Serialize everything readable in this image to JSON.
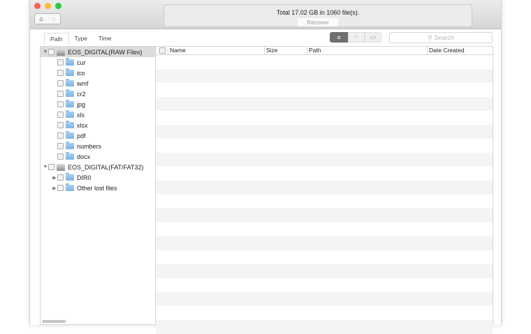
{
  "window": {
    "traffic_lights": {
      "close": "#fc5f57",
      "minimize": "#fdbc2e",
      "maximize": "#29c940"
    }
  },
  "toolbar": {
    "home_icon": "⌂",
    "back_icon": "○",
    "status_text": "Total 17.02 GB in 1060 file(s).",
    "recover_label": "Recover"
  },
  "tabs": [
    "Path",
    "Type",
    "Time"
  ],
  "view_icons": [
    "≡",
    "⁘",
    "▭"
  ],
  "search": {
    "placeholder": "Search",
    "icon": "⚲"
  },
  "tree": [
    {
      "label": "EOS_DIGITAL(RAW Files)",
      "type": "drive",
      "level": 0,
      "expand": "▼",
      "selected": true
    },
    {
      "label": "cur",
      "type": "folder",
      "level": 1
    },
    {
      "label": "ico",
      "type": "folder",
      "level": 1
    },
    {
      "label": "wmf",
      "type": "folder",
      "level": 1
    },
    {
      "label": "cr2",
      "type": "folder",
      "level": 1
    },
    {
      "label": "jpg",
      "type": "folder",
      "level": 1
    },
    {
      "label": "xls",
      "type": "folder",
      "level": 1
    },
    {
      "label": "xlsx",
      "type": "folder",
      "level": 1
    },
    {
      "label": "pdf",
      "type": "folder",
      "level": 1
    },
    {
      "label": "numbers",
      "type": "folder",
      "level": 1
    },
    {
      "label": "docx",
      "type": "folder",
      "level": 1
    },
    {
      "label": "EOS_DIGITAL(FAT/FAT32)",
      "type": "drive",
      "level": 0,
      "expand": "▼"
    },
    {
      "label": "DIR0",
      "type": "folder",
      "level": 1,
      "expand": "▶"
    },
    {
      "label": "Other lost files",
      "type": "folder",
      "level": 1,
      "expand": "▶"
    }
  ],
  "table": {
    "columns": [
      "Name",
      "Size",
      "Path",
      "Date Created"
    ]
  }
}
